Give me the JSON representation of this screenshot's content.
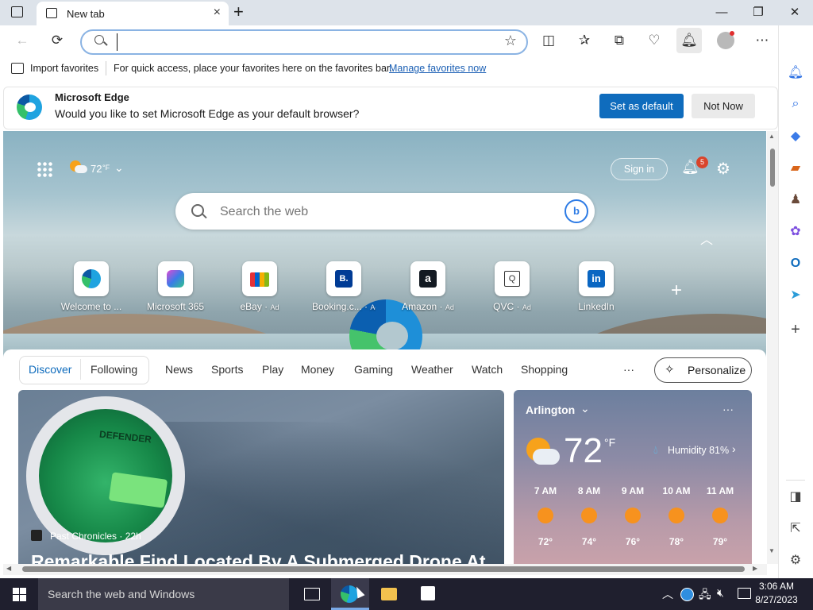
{
  "titlebar": {
    "tab_label": "New tab",
    "new_tab_symbol": "+",
    "minimize": "—",
    "restore": "❐",
    "close": "✕"
  },
  "toolbar": {
    "address_value": "",
    "address_placeholder": ""
  },
  "favorites_bar": {
    "import_label": "Import favorites",
    "hint": "For quick access, place your favorites here on the favorites bar.",
    "manage_link": "Manage favorites now"
  },
  "infobar": {
    "title": "Microsoft Edge",
    "message": "Would you like to set Microsoft Edge as your default browser?",
    "primary_button": "Set as default",
    "secondary_button": "Not Now"
  },
  "hero": {
    "temperature": "72",
    "temp_unit": "°F",
    "sign_in": "Sign in",
    "notification_count": "5",
    "search_placeholder": "Search the web",
    "quick_links": [
      {
        "label": "Welcome to ...",
        "ad": "",
        "icon": "edge-icon"
      },
      {
        "label": "Microsoft 365",
        "ad": "",
        "icon": "m365-icon"
      },
      {
        "label": "eBay",
        "ad": "Ad",
        "icon": "ebay-icon"
      },
      {
        "label": "Booking.c...",
        "ad": "Ad",
        "icon": "booking-icon"
      },
      {
        "label": "Amazon",
        "ad": "Ad",
        "icon": "amazon-icon"
      },
      {
        "label": "QVC",
        "ad": "Ad",
        "icon": "qvc-icon"
      },
      {
        "label": "LinkedIn",
        "ad": "",
        "icon": "linkedin-icon"
      }
    ],
    "booking_letter": "B.",
    "amazon_letter": "a",
    "qvc_letter": "Q",
    "linkedin_letters": "in"
  },
  "feed_nav": {
    "discover": "Discover",
    "following": "Following",
    "items": [
      "News",
      "Sports",
      "Play",
      "Money",
      "Gaming",
      "Weather",
      "Watch",
      "Shopping"
    ],
    "more": "···",
    "personalize": "Personalize"
  },
  "article": {
    "source": "Past Chronicles",
    "age": "22h",
    "headline": "Remarkable Find Located By A Submerged Drone At",
    "image_text": "DEFENDER"
  },
  "weather": {
    "city": "Arlington",
    "temp": "72",
    "unit": "°F",
    "humidity": "Humidity 81%",
    "more": "···",
    "hours": [
      {
        "time": "7 AM",
        "temp": "72°"
      },
      {
        "time": "8 AM",
        "temp": "74°"
      },
      {
        "time": "9 AM",
        "temp": "76°"
      },
      {
        "time": "10 AM",
        "temp": "78°"
      },
      {
        "time": "11 AM",
        "temp": "79°"
      }
    ]
  },
  "taskbar": {
    "search_placeholder": "Search the web and Windows",
    "time": "3:06 AM",
    "date": "8/27/2023"
  },
  "colors": {
    "accent": "#0f6cbd",
    "link": "#1a5fb4"
  }
}
